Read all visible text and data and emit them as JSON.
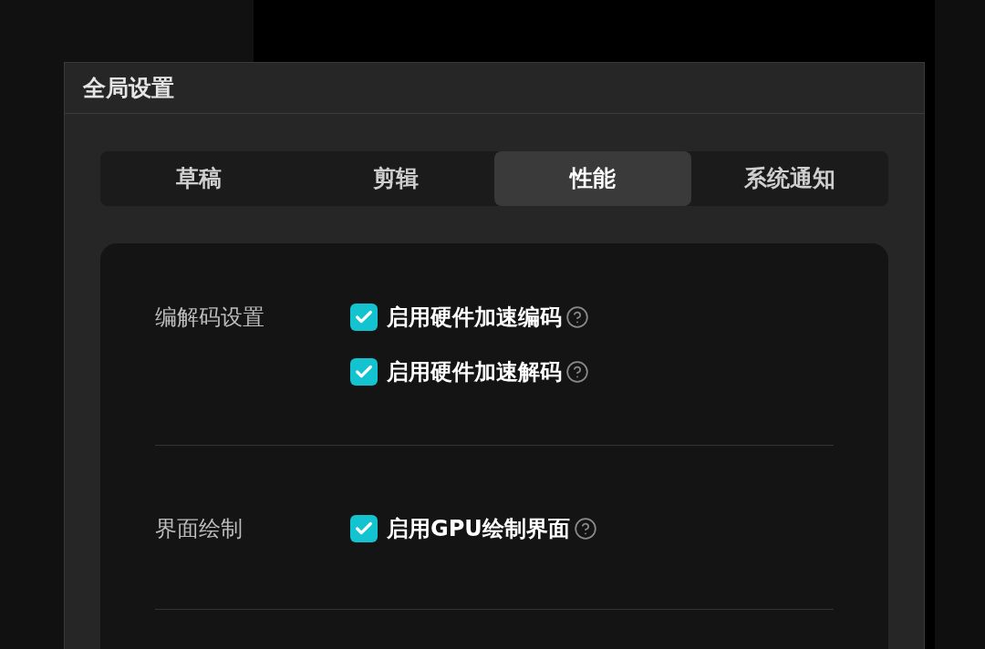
{
  "dialog": {
    "title": "全局设置"
  },
  "tabs": [
    {
      "label": "草稿",
      "selected": false
    },
    {
      "label": "剪辑",
      "selected": false
    },
    {
      "label": "性能",
      "selected": true
    },
    {
      "label": "系统通知",
      "selected": false
    }
  ],
  "sections": [
    {
      "label": "编解码设置",
      "options": [
        {
          "label": "启用硬件加速编码",
          "checked": true
        },
        {
          "label": "启用硬件加速解码",
          "checked": true
        }
      ]
    },
    {
      "label": "界面绘制",
      "options": [
        {
          "label": "启用GPU绘制界面",
          "checked": true
        }
      ]
    }
  ]
}
